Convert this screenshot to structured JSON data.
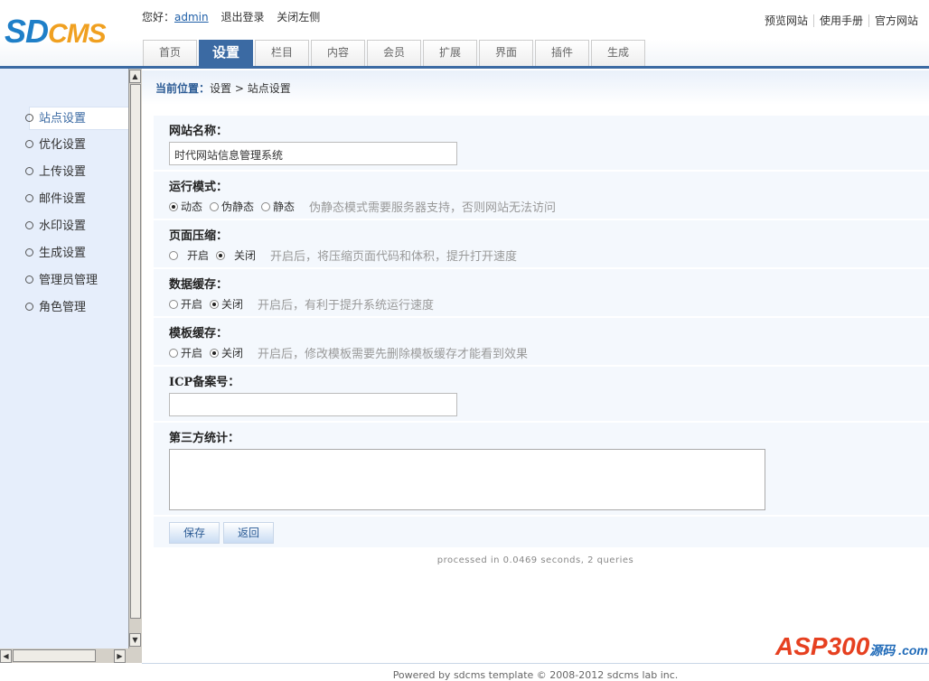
{
  "logo": {
    "part1": "SD",
    "part2": "CMS"
  },
  "userbar": {
    "greeting": "您好：",
    "user": "admin",
    "logout": "退出登录",
    "close_left": "关闭左侧"
  },
  "toplinks": [
    "预览网站",
    "使用手册",
    "官方网站"
  ],
  "tabs": [
    "首页",
    "设置",
    "栏目",
    "内容",
    "会员",
    "扩展",
    "界面",
    "插件",
    "生成"
  ],
  "active_tab": 1,
  "sidebar": [
    "站点设置",
    "优化设置",
    "上传设置",
    "邮件设置",
    "水印设置",
    "生成设置",
    "管理员管理",
    "角色管理"
  ],
  "breadcrumb": {
    "label": "当前位置：",
    "path": "设置 > 站点设置"
  },
  "form": {
    "site_name": {
      "label": "网站名称：",
      "value": "时代网站信息管理系统"
    },
    "run_mode": {
      "label": "运行模式：",
      "options": [
        "动态",
        "伪静态",
        "静态"
      ],
      "selected": "动态",
      "hint": "伪静态模式需要服务器支持，否则网站无法访问"
    },
    "compress": {
      "label": "页面压缩：",
      "options": [
        "开启",
        "关闭"
      ],
      "selected": "关闭",
      "hint": "开启后，将压缩页面代码和体积，提升打开速度"
    },
    "data_cache": {
      "label": "数据缓存：",
      "options": [
        "开启",
        "关闭"
      ],
      "selected": "关闭",
      "hint": "开启后，有利于提升系统运行速度"
    },
    "tpl_cache": {
      "label": "模板缓存：",
      "options": [
        "开启",
        "关闭"
      ],
      "selected": "关闭",
      "hint": "开启后，修改模板需要先删除模板缓存才能看到效果"
    },
    "icp": {
      "label": "ICP备案号：",
      "value": ""
    },
    "stats": {
      "label": "第三方统计：",
      "value": ""
    },
    "save": "保存",
    "back": "返回"
  },
  "processed": "processed in 0.0469 seconds, 2 queries",
  "powered": "Powered by sdcms template © 2008-2012 sdcms lab inc.",
  "watermark": {
    "brand": "ASP300",
    "suffix": "源码 .com"
  }
}
